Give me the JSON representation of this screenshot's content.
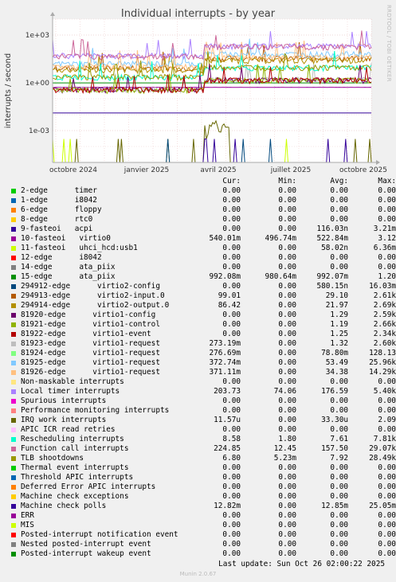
{
  "title": "Individual interrupts - by year",
  "side_label": "RRDTOOL / TOBI OETIKER",
  "footer": {
    "last_update": "Last update: Sun Oct 26 02:00:22 2025",
    "munin": "Munin 2.0.67"
  },
  "legend_headers": {
    "cur": "Cur:",
    "min": "Min:",
    "avg": "Avg:",
    "max": "Max:"
  },
  "chart_data": {
    "type": "line",
    "title": "Individual interrupts - by year",
    "ylabel": "interrupts / second",
    "yscale": "log",
    "ylim": [
      1e-05,
      10000
    ],
    "yticks": [
      "1e-03",
      "1e+00",
      "1e+03"
    ],
    "xticks": [
      "octobre 2024",
      "janvier 2025",
      "avril 2025",
      "juillet 2025",
      "octobre 2025"
    ],
    "grid": true,
    "series": [
      {
        "name": "2-edge      timer",
        "color": "#00cc00",
        "cur": "0.00",
        "min": "0.00",
        "avg": "0.00",
        "max": "0.00"
      },
      {
        "name": "1-edge      i8042",
        "color": "#0066b3",
        "cur": "0.00",
        "min": "0.00",
        "avg": "0.00",
        "max": "0.00"
      },
      {
        "name": "6-edge      floppy",
        "color": "#ff8000",
        "cur": "0.00",
        "min": "0.00",
        "avg": "0.00",
        "max": "0.00"
      },
      {
        "name": "8-edge      rtc0",
        "color": "#ffcc00",
        "cur": "0.00",
        "min": "0.00",
        "avg": "0.00",
        "max": "0.00"
      },
      {
        "name": "9-fasteoi   acpi",
        "color": "#330099",
        "cur": "0.00",
        "min": "0.00",
        "avg": "116.03n",
        "max": "3.21m"
      },
      {
        "name": "10-fasteoi   virtio0",
        "color": "#990099",
        "cur": "540.01m",
        "min": "496.74m",
        "avg": "522.84m",
        "max": "3.12"
      },
      {
        "name": "11-fasteoi   uhci_hcd:usb1",
        "color": "#ccff00",
        "cur": "0.00",
        "min": "0.00",
        "avg": "58.02n",
        "max": "6.36m"
      },
      {
        "name": "12-edge      i8042",
        "color": "#ff0000",
        "cur": "0.00",
        "min": "0.00",
        "avg": "0.00",
        "max": "0.00"
      },
      {
        "name": "14-edge      ata_piix",
        "color": "#808080",
        "cur": "0.00",
        "min": "0.00",
        "avg": "0.00",
        "max": "0.00"
      },
      {
        "name": "15-edge      ata_piix",
        "color": "#008f00",
        "cur": "992.08m",
        "min": "980.64m",
        "avg": "992.07m",
        "max": "1.20"
      },
      {
        "name": "294912-edge      virtio2-config",
        "color": "#00487d",
        "cur": "0.00",
        "min": "0.00",
        "avg": "580.15n",
        "max": "16.03m"
      },
      {
        "name": "294913-edge      virtio2-input.0",
        "color": "#b35a00",
        "cur": "99.01",
        "min": "0.00",
        "avg": "29.10",
        "max": "2.61k"
      },
      {
        "name": "294914-edge      virtio2-output.0",
        "color": "#b38f00",
        "cur": "86.42",
        "min": "0.00",
        "avg": "21.97",
        "max": "2.69k"
      },
      {
        "name": "81920-edge      virtio1-config",
        "color": "#6b006b",
        "cur": "0.00",
        "min": "0.00",
        "avg": "1.29",
        "max": "2.59k"
      },
      {
        "name": "81921-edge      virtio1-control",
        "color": "#8fb300",
        "cur": "0.00",
        "min": "0.00",
        "avg": "1.19",
        "max": "2.66k"
      },
      {
        "name": "81922-edge      virtio1-event",
        "color": "#b30000",
        "cur": "0.00",
        "min": "0.00",
        "avg": "1.25",
        "max": "2.34k"
      },
      {
        "name": "81923-edge      virtio1-request",
        "color": "#bebebe",
        "cur": "273.19m",
        "min": "0.00",
        "avg": "1.32",
        "max": "2.60k"
      },
      {
        "name": "81924-edge      virtio1-request",
        "color": "#80ff80",
        "cur": "276.69m",
        "min": "0.00",
        "avg": "78.80m",
        "max": "128.13"
      },
      {
        "name": "81925-edge      virtio1-request",
        "color": "#80c9ff",
        "cur": "372.74m",
        "min": "0.00",
        "avg": "53.49",
        "max": "25.96k"
      },
      {
        "name": "81926-edge      virtio1-request",
        "color": "#ffc080",
        "cur": "371.11m",
        "min": "0.00",
        "avg": "34.38",
        "max": "14.29k"
      },
      {
        "name": "Non-maskable interrupts",
        "color": "#ffe680",
        "cur": "0.00",
        "min": "0.00",
        "avg": "0.00",
        "max": "0.00"
      },
      {
        "name": "Local timer interrupts",
        "color": "#aa80ff",
        "cur": "203.73",
        "min": "74.06",
        "avg": "176.59",
        "max": "5.40k"
      },
      {
        "name": "Spurious interrupts",
        "color": "#ee00cc",
        "cur": "0.00",
        "min": "0.00",
        "avg": "0.00",
        "max": "0.00"
      },
      {
        "name": "Performance monitoring interrupts",
        "color": "#ff8080",
        "cur": "0.00",
        "min": "0.00",
        "avg": "0.00",
        "max": "0.00"
      },
      {
        "name": "IRQ work interrupts",
        "color": "#666600",
        "cur": "11.57u",
        "min": "0.00",
        "avg": "33.30u",
        "max": "2.09"
      },
      {
        "name": "APIC ICR read retries",
        "color": "#ffbfff",
        "cur": "0.00",
        "min": "0.00",
        "avg": "0.00",
        "max": "0.00"
      },
      {
        "name": "Rescheduling interrupts",
        "color": "#00ffcc",
        "cur": "8.58",
        "min": "1.80",
        "avg": "7.61",
        "max": "7.81k"
      },
      {
        "name": "Function call interrupts",
        "color": "#cc6699",
        "cur": "224.85",
        "min": "12.45",
        "avg": "157.50",
        "max": "29.07k"
      },
      {
        "name": "TLB shootdowns",
        "color": "#999900",
        "cur": "6.80",
        "min": "5.23m",
        "avg": "7.92",
        "max": "28.49k"
      },
      {
        "name": "Thermal event interrupts",
        "color": "#00cc00",
        "cur": "0.00",
        "min": "0.00",
        "avg": "0.00",
        "max": "0.00"
      },
      {
        "name": "Threshold APIC interrupts",
        "color": "#0066b3",
        "cur": "0.00",
        "min": "0.00",
        "avg": "0.00",
        "max": "0.00"
      },
      {
        "name": "Deferred Error APIC interrupts",
        "color": "#ff8000",
        "cur": "0.00",
        "min": "0.00",
        "avg": "0.00",
        "max": "0.00"
      },
      {
        "name": "Machine check exceptions",
        "color": "#ffcc00",
        "cur": "0.00",
        "min": "0.00",
        "avg": "0.00",
        "max": "0.00"
      },
      {
        "name": "Machine check polls",
        "color": "#330099",
        "cur": "12.82m",
        "min": "0.00",
        "avg": "12.85m",
        "max": "25.05m"
      },
      {
        "name": "ERR",
        "color": "#990099",
        "cur": "0.00",
        "min": "0.00",
        "avg": "0.00",
        "max": "0.00"
      },
      {
        "name": "MIS",
        "color": "#ccff00",
        "cur": "0.00",
        "min": "0.00",
        "avg": "0.00",
        "max": "0.00"
      },
      {
        "name": "Posted-interrupt notification event",
        "color": "#ff0000",
        "cur": "0.00",
        "min": "0.00",
        "avg": "0.00",
        "max": "0.00"
      },
      {
        "name": "Nested posted-interrupt event",
        "color": "#808080",
        "cur": "0.00",
        "min": "0.00",
        "avg": "0.00",
        "max": "0.00"
      },
      {
        "name": "Posted-interrupt wakeup event",
        "color": "#008f00",
        "cur": "0.00",
        "min": "0.00",
        "avg": "0.00",
        "max": "0.00"
      }
    ]
  }
}
